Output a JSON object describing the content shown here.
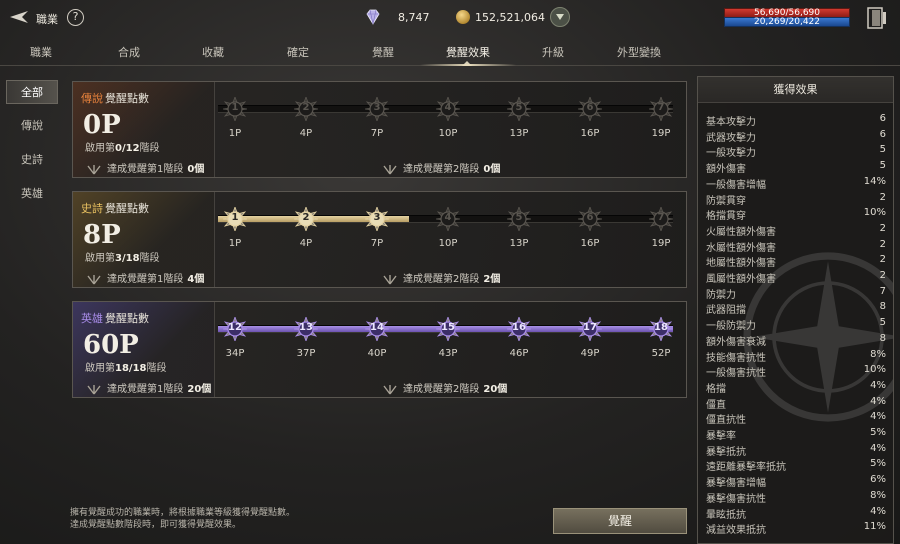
{
  "header": {
    "job_title": "職業",
    "help": "?",
    "gem_count": "8,747",
    "coin_count": "152,521,064",
    "hp": "56,690/56,690",
    "mp": "20,269/20,422"
  },
  "tabs": [
    {
      "label": "職業"
    },
    {
      "label": "合成"
    },
    {
      "label": "收藏"
    },
    {
      "label": "確定"
    },
    {
      "label": "覺醒"
    },
    {
      "label": "覺醒效果",
      "active": true
    },
    {
      "label": "升級"
    },
    {
      "label": "外型變換"
    }
  ],
  "sidebar": [
    {
      "label": "全部",
      "active": true
    },
    {
      "label": "傳說"
    },
    {
      "label": "史詩"
    },
    {
      "label": "英雄"
    }
  ],
  "cards": [
    {
      "grade": "傳說",
      "title": "覺醒點數",
      "points": "0P",
      "stage_prefix": "啟用第",
      "stage_value": "0/12",
      "stage_suffix": "階段",
      "fill_fraction": 0,
      "nodes": [
        {
          "num": "1",
          "label": "1P",
          "on": false
        },
        {
          "num": "2",
          "label": "4P",
          "on": false
        },
        {
          "num": "3",
          "label": "7P",
          "on": false
        },
        {
          "num": "4",
          "label": "10P",
          "on": false
        },
        {
          "num": "5",
          "label": "13P",
          "on": false
        },
        {
          "num": "6",
          "label": "16P",
          "on": false
        },
        {
          "num": "7",
          "label": "19P",
          "on": false
        }
      ],
      "ach1": "達成覺醒第1階段",
      "ach1_count": "0個",
      "ach2": "達成覺醒第2階段",
      "ach2_count": "0個"
    },
    {
      "grade": "史詩",
      "title": "覺醒點數",
      "points": "8P",
      "stage_prefix": "啟用第",
      "stage_value": "3/18",
      "stage_suffix": "階段",
      "fill_fraction": 0.42,
      "nodes": [
        {
          "num": "1",
          "label": "1P",
          "on": true
        },
        {
          "num": "2",
          "label": "4P",
          "on": true
        },
        {
          "num": "3",
          "label": "7P",
          "on": true
        },
        {
          "num": "4",
          "label": "10P",
          "on": false
        },
        {
          "num": "5",
          "label": "13P",
          "on": false
        },
        {
          "num": "6",
          "label": "16P",
          "on": false
        },
        {
          "num": "7",
          "label": "19P",
          "on": false
        }
      ],
      "ach1": "達成覺醒第1階段",
      "ach1_count": "4個",
      "ach2": "達成覺醒第2階段",
      "ach2_count": "2個"
    },
    {
      "grade": "英雄",
      "title": "覺醒點數",
      "points": "60P",
      "stage_prefix": "啟用第",
      "stage_value": "18/18",
      "stage_suffix": "階段",
      "fill_fraction": 1,
      "nodes": [
        {
          "num": "12",
          "label": "34P",
          "on": true
        },
        {
          "num": "13",
          "label": "37P",
          "on": true
        },
        {
          "num": "14",
          "label": "40P",
          "on": true
        },
        {
          "num": "15",
          "label": "43P",
          "on": true
        },
        {
          "num": "16",
          "label": "46P",
          "on": true
        },
        {
          "num": "17",
          "label": "49P",
          "on": true
        },
        {
          "num": "18",
          "label": "52P",
          "on": true
        }
      ],
      "ach1": "達成覺醒第1階段",
      "ach1_count": "20個",
      "ach2": "達成覺醒第2階段",
      "ach2_count": "20個"
    }
  ],
  "effects": {
    "title": "獲得效果",
    "stats": [
      {
        "name": "基本攻擊力",
        "value": "6"
      },
      {
        "name": "武器攻擊力",
        "value": "6"
      },
      {
        "name": "一般攻擊力",
        "value": "5"
      },
      {
        "name": "額外傷害",
        "value": "5"
      },
      {
        "name": "一般傷害增幅",
        "value": "14%"
      },
      {
        "name": "防禦貫穿",
        "value": "2"
      },
      {
        "name": "格擋貫穿",
        "value": "10%"
      },
      {
        "name": "火屬性額外傷害",
        "value": "2"
      },
      {
        "name": "水屬性額外傷害",
        "value": "2"
      },
      {
        "name": "地屬性額外傷害",
        "value": "2"
      },
      {
        "name": "風屬性額外傷害",
        "value": "2"
      },
      {
        "name": "防禦力",
        "value": "7"
      },
      {
        "name": "武器阻擋",
        "value": "8"
      },
      {
        "name": "一般防禦力",
        "value": "5"
      },
      {
        "name": "額外傷害衰減",
        "value": "8"
      },
      {
        "name": "技能傷害抗性",
        "value": "8%"
      },
      {
        "name": "一般傷害抗性",
        "value": "10%"
      },
      {
        "name": "格擋",
        "value": "4%"
      },
      {
        "name": "僵直",
        "value": "4%"
      },
      {
        "name": "僵直抗性",
        "value": "4%"
      },
      {
        "name": "暴擊率",
        "value": "5%"
      },
      {
        "name": "暴擊抵抗",
        "value": "4%"
      },
      {
        "name": "遠距離暴擊率抵抗",
        "value": "5%"
      },
      {
        "name": "暴擊傷害增幅",
        "value": "6%"
      },
      {
        "name": "暴擊傷害抗性",
        "value": "8%"
      },
      {
        "name": "暈眩抵抗",
        "value": "4%"
      },
      {
        "name": "減益效果抵抗",
        "value": "11%"
      }
    ]
  },
  "footnote": [
    "擁有覺醒成功的職業時，將根據職業等級獲得覺醒點數。",
    "達成覺醒點數階段時，即可獲得覺醒效果。"
  ],
  "awaken_button": "覺醒",
  "colors": {
    "legend": "#e8823c",
    "epic": "#e8c060",
    "hero": "#a88ce8",
    "epic_fill": "#d8c48e",
    "hero_fill": "#8c70d0"
  }
}
